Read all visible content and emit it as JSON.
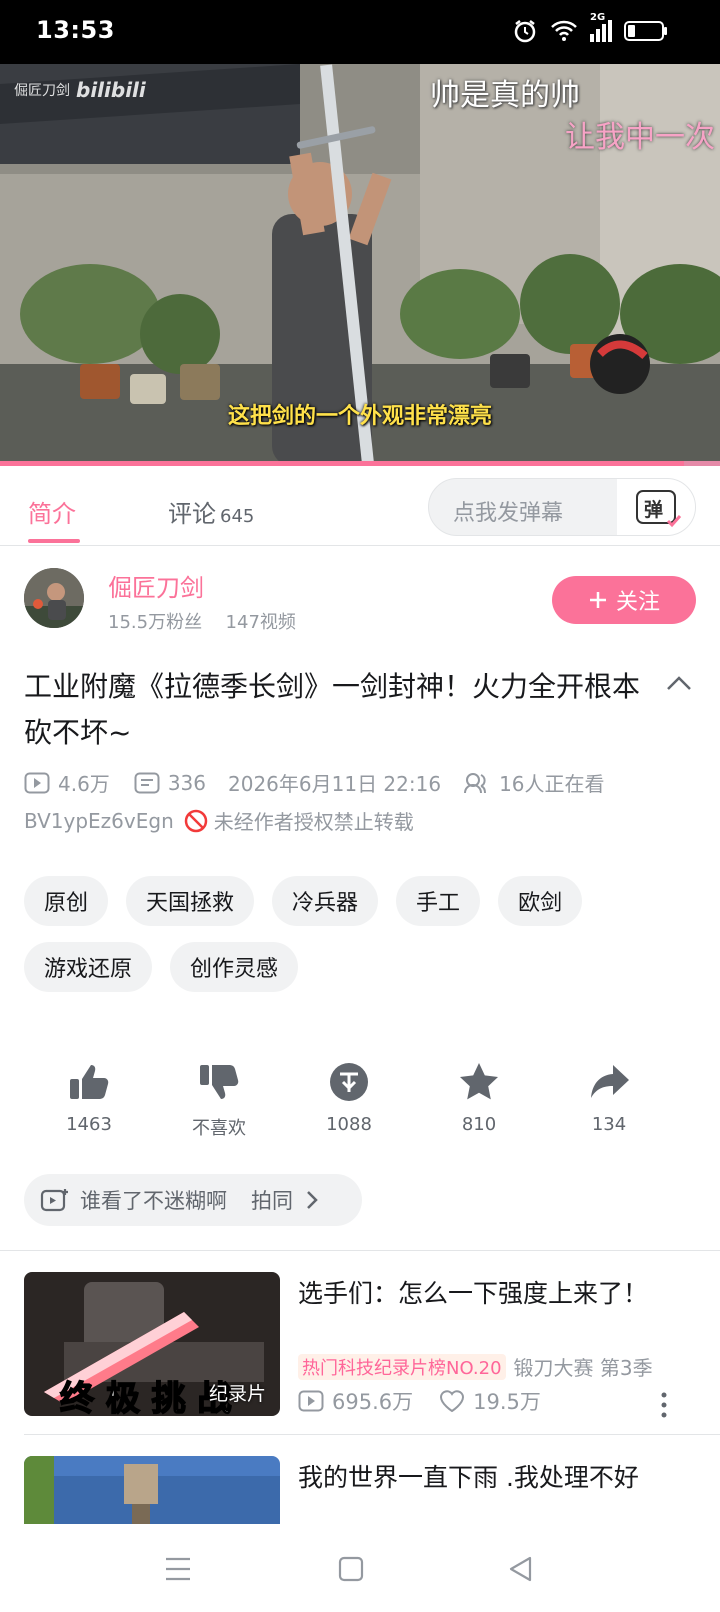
{
  "status_bar": {
    "time": "13:53",
    "network": "2G"
  },
  "video": {
    "watermark_name": "倔匠刀剑",
    "watermark_logo": "bilibili",
    "danmaku": [
      "帅是真的帅",
      "让我中一次"
    ],
    "subtitle": "这把剑的一个外观非常漂亮",
    "progress": 0.95
  },
  "tabs": {
    "intro": "简介",
    "comments": "评论",
    "comments_count": "645",
    "danmaku_placeholder": "点我发弹幕",
    "danmaku_btn_icon": "弹"
  },
  "uploader": {
    "name": "倔匠刀剑",
    "fans": "15.5万粉丝",
    "videos": "147视频",
    "follow_label": "关注"
  },
  "title": "工业附魔《拉德季长剑》一剑封神！火力全开根本砍不坏~",
  "stats": {
    "plays": "4.6万",
    "danmaku": "336",
    "date": "2026年6月11日 22:16",
    "watching": "16人正在看",
    "bvid": "BV1ypEz6vEgn",
    "no_repost": "未经作者授权禁止转载"
  },
  "tags": [
    "原创",
    "天国拯救",
    "冷兵器",
    "手工",
    "欧剑",
    "游戏还原",
    "创作灵感"
  ],
  "actions": {
    "like": "1463",
    "dislike": "不喜欢",
    "coin": "1088",
    "fav": "810",
    "share": "134"
  },
  "notes": {
    "text": "谁看了不迷糊啊",
    "extra": "拍同"
  },
  "recommendations": [
    {
      "title": "选手们：怎么一下强度上来了！",
      "badge": "热门科技纪录片榜NO.20",
      "series": "锻刀大赛 第3季",
      "views": "695.6万",
      "likes": "19.5万",
      "thumb_caption": "终 极 挑 战",
      "thumb_tag": "纪录片"
    },
    {
      "title": "我的世界一直下雨 .我处理不好"
    }
  ],
  "colors": {
    "accent": "#fb7299",
    "text": "#18191c",
    "muted": "#9499a0"
  }
}
